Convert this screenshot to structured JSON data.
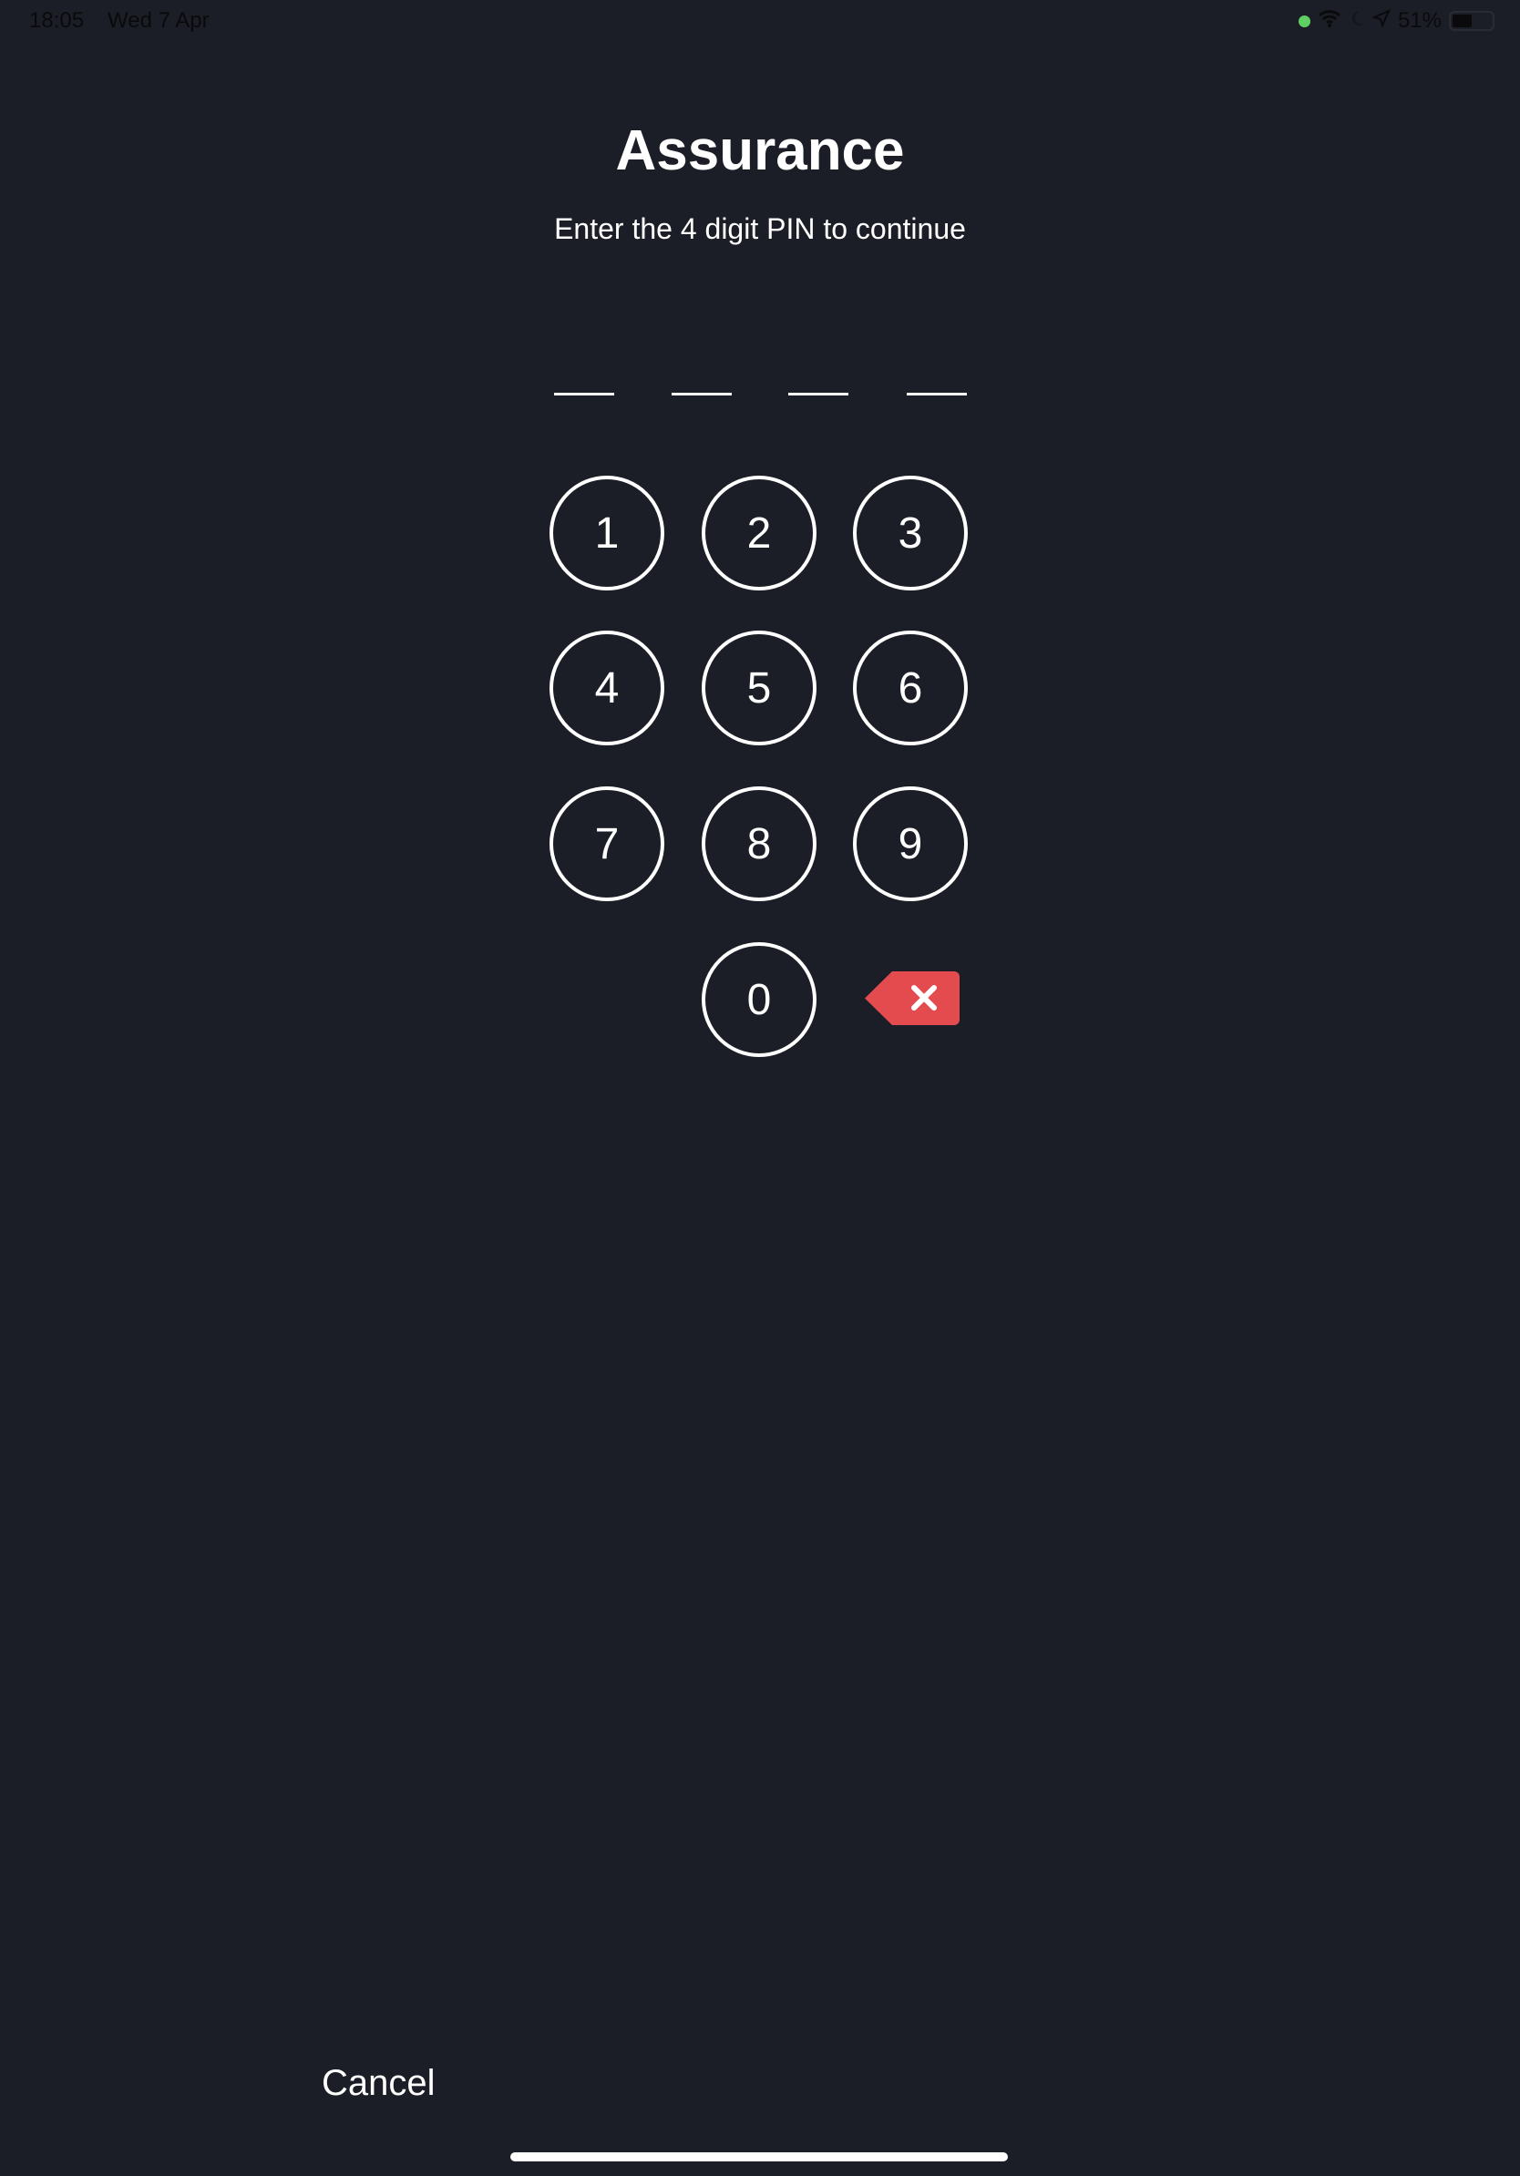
{
  "status_bar": {
    "time": "18:05",
    "date": "Wed 7 Apr",
    "battery": "51%",
    "battery_level": 0.51
  },
  "title": "Assurance",
  "subtitle": "Enter the 4 digit PIN to continue",
  "pin": {
    "length": 4,
    "entered": 0
  },
  "keys": [
    "1",
    "2",
    "3",
    "4",
    "5",
    "6",
    "7",
    "8",
    "9",
    "0"
  ],
  "backspace_color": "#e34b4f",
  "cancel_label": "Cancel"
}
